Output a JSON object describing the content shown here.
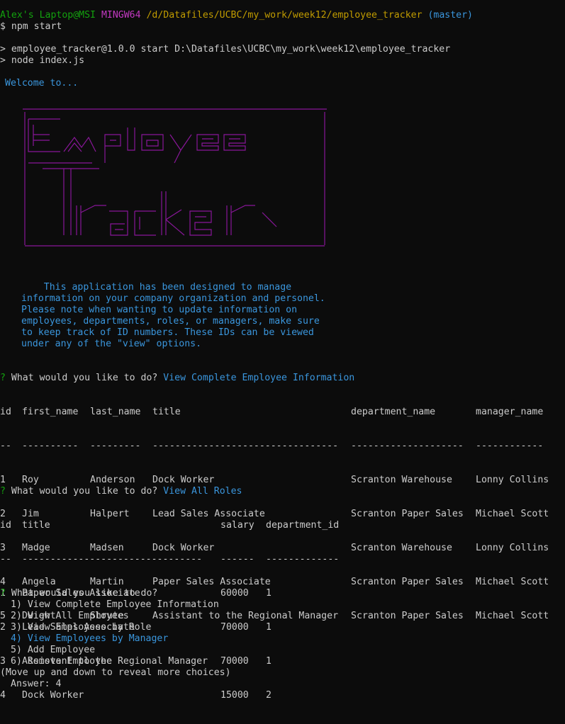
{
  "prompt": {
    "user_host": "Alex's Laptop@MSI",
    "shell": "MINGW64",
    "path": "/d/Datafiles/UCBC/my_work/week12/employee_tracker",
    "branch": "(master)",
    "symbol": "$",
    "command": "npm start"
  },
  "npm_output": {
    "line1": "> employee_tracker@1.0.0 start D:\\Datafiles\\UCBC\\my_work\\week12\\employee_tracker",
    "line2": "> node index.js"
  },
  "welcome": "Welcome to...",
  "banner_words": [
    "Employee",
    "Tracker"
  ],
  "description": [
    "    This application has been designed to manage",
    "information on your company organization and personel.",
    "Please note when wanting to update information on",
    "employees, departments, roles, or managers, make sure",
    "to keep track of ID numbers. These IDs can be viewed",
    "under any of the \"view\" options."
  ],
  "question_mark": "?",
  "question": "What would you like to do?",
  "query1": {
    "answer": "View Complete Employee Information",
    "headers": [
      "id",
      "first_name",
      "last_name",
      "title",
      "department_name",
      "manager_name"
    ],
    "dividers": [
      "--",
      "----------",
      "---------",
      "---------------------------------",
      "--------------------",
      "------------"
    ],
    "rows": [
      [
        "1",
        "Roy",
        "Anderson",
        "Dock Worker",
        "Scranton Warehouse",
        "Lonny Collins"
      ],
      [
        "2",
        "Jim",
        "Halpert",
        "Lead Sales Associate",
        "Scranton Paper Sales",
        "Michael Scott"
      ],
      [
        "3",
        "Madge",
        "Madsen",
        "Dock Worker",
        "Scranton Warehouse",
        "Lonny Collins"
      ],
      [
        "4",
        "Angela",
        "Martin",
        "Paper Sales Associate",
        "Scranton Paper Sales",
        "Michael Scott"
      ],
      [
        "5",
        "Dwight",
        "Shrute",
        "Assistant to the Regional Manager",
        "Scranton Paper Sales",
        "Michael Scott"
      ]
    ]
  },
  "query2": {
    "answer": "View All Roles",
    "headers": [
      "id",
      "title",
      "salary",
      "department_id"
    ],
    "dividers": [
      "--",
      "--------------------------------",
      "------",
      "-------------"
    ],
    "rows": [
      [
        "1",
        "Paper Sales Associate",
        "60000",
        "1"
      ],
      [
        "2",
        "Lead Sales Associate",
        "70000",
        "1"
      ],
      [
        "3",
        "Assistant to the Regional Manager",
        "70000",
        "1"
      ],
      [
        "4",
        "Dock Worker",
        "15000",
        "2"
      ]
    ]
  },
  "menu": {
    "options": [
      "1) View Complete Employee Information",
      "2) View All Employees",
      "3) View Employees by Role",
      "4) View Employees by Manager",
      "5) Add Employee",
      "6) Remove Employee"
    ],
    "selected_index": 3,
    "hint": "(Move up and down to reveal more choices)",
    "answer_label": "Answer:",
    "answer_value": "4"
  },
  "colors": {
    "background": "#0c0c0c",
    "text": "#cccccc",
    "green": "#13a10e",
    "magenta": "#c239c1",
    "yellow": "#c19c00",
    "cyan": "#3a96dd",
    "banner_purple": "#881798"
  }
}
